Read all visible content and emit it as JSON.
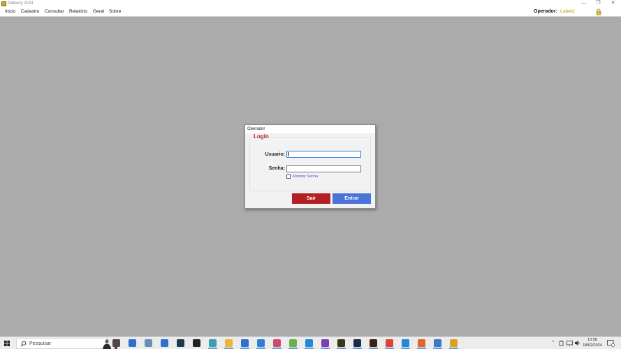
{
  "window": {
    "title": "Delivery 2024",
    "controls": {
      "minimize": "—",
      "restore": "❐",
      "close": "✕"
    }
  },
  "menu": {
    "items": [
      "Inicio",
      "Cadastro",
      "Consultar",
      "Relatório",
      "Geral",
      "Sobre"
    ],
    "operador_label": "Operador:",
    "operador_value": "Label2"
  },
  "dialog": {
    "title": "Operador",
    "group_title": "Login",
    "usuario_label": "Usuario:",
    "usuario_value": "",
    "senha_label": "Senha:",
    "senha_value": "",
    "show_password_label": "Mostrar Senha",
    "show_password_checked": false,
    "sair_label": "Sair",
    "entrar_label": "Entrar"
  },
  "taskbar": {
    "search_placeholder": "Pesquisar",
    "time": "13:58",
    "date": "18/02/2024",
    "apps": [
      {
        "name": "task-view-icon",
        "color": "#4a4a4a"
      },
      {
        "name": "app-blue-icon",
        "color": "#2f6fd0"
      },
      {
        "name": "network-app-icon",
        "color": "#6a8fb5"
      },
      {
        "name": "tablet-icon",
        "color": "#2f6fd0"
      },
      {
        "name": "visual-studio-v-icon",
        "color": "#1d3b4a"
      },
      {
        "name": "github-icon",
        "color": "#222222"
      },
      {
        "name": "feather-icon",
        "color": "#3aa0b5"
      },
      {
        "name": "file-explorer-icon",
        "color": "#e8b73a"
      },
      {
        "name": "store-icon",
        "color": "#2f6fd0"
      },
      {
        "name": "mail-icon",
        "color": "#2f7fd6"
      },
      {
        "name": "paint-icon",
        "color": "#d04a70"
      },
      {
        "name": "notepad-plus-icon",
        "color": "#6ab04c"
      },
      {
        "name": "vscode-icon",
        "color": "#1f8ad8"
      },
      {
        "name": "visual-studio-icon",
        "color": "#7b3fb5"
      },
      {
        "name": "fireworks-icon",
        "color": "#3a3a12"
      },
      {
        "name": "photoshop-icon",
        "color": "#1c2a4a"
      },
      {
        "name": "illustrator-icon",
        "color": "#3a2410"
      },
      {
        "name": "chrome-icon",
        "color": "#db4437"
      },
      {
        "name": "edge-icon",
        "color": "#1f8ad8"
      },
      {
        "name": "firefox-icon",
        "color": "#e0662a"
      },
      {
        "name": "code-editor-icon",
        "color": "#3a78c8"
      },
      {
        "name": "delivery-app-icon",
        "color": "#d9a521"
      }
    ]
  },
  "colors": {
    "accent_red": "#b31f22",
    "accent_blue": "#4a73d8",
    "operador_gold": "#d4a92a",
    "desktop_gray": "#ababab"
  }
}
